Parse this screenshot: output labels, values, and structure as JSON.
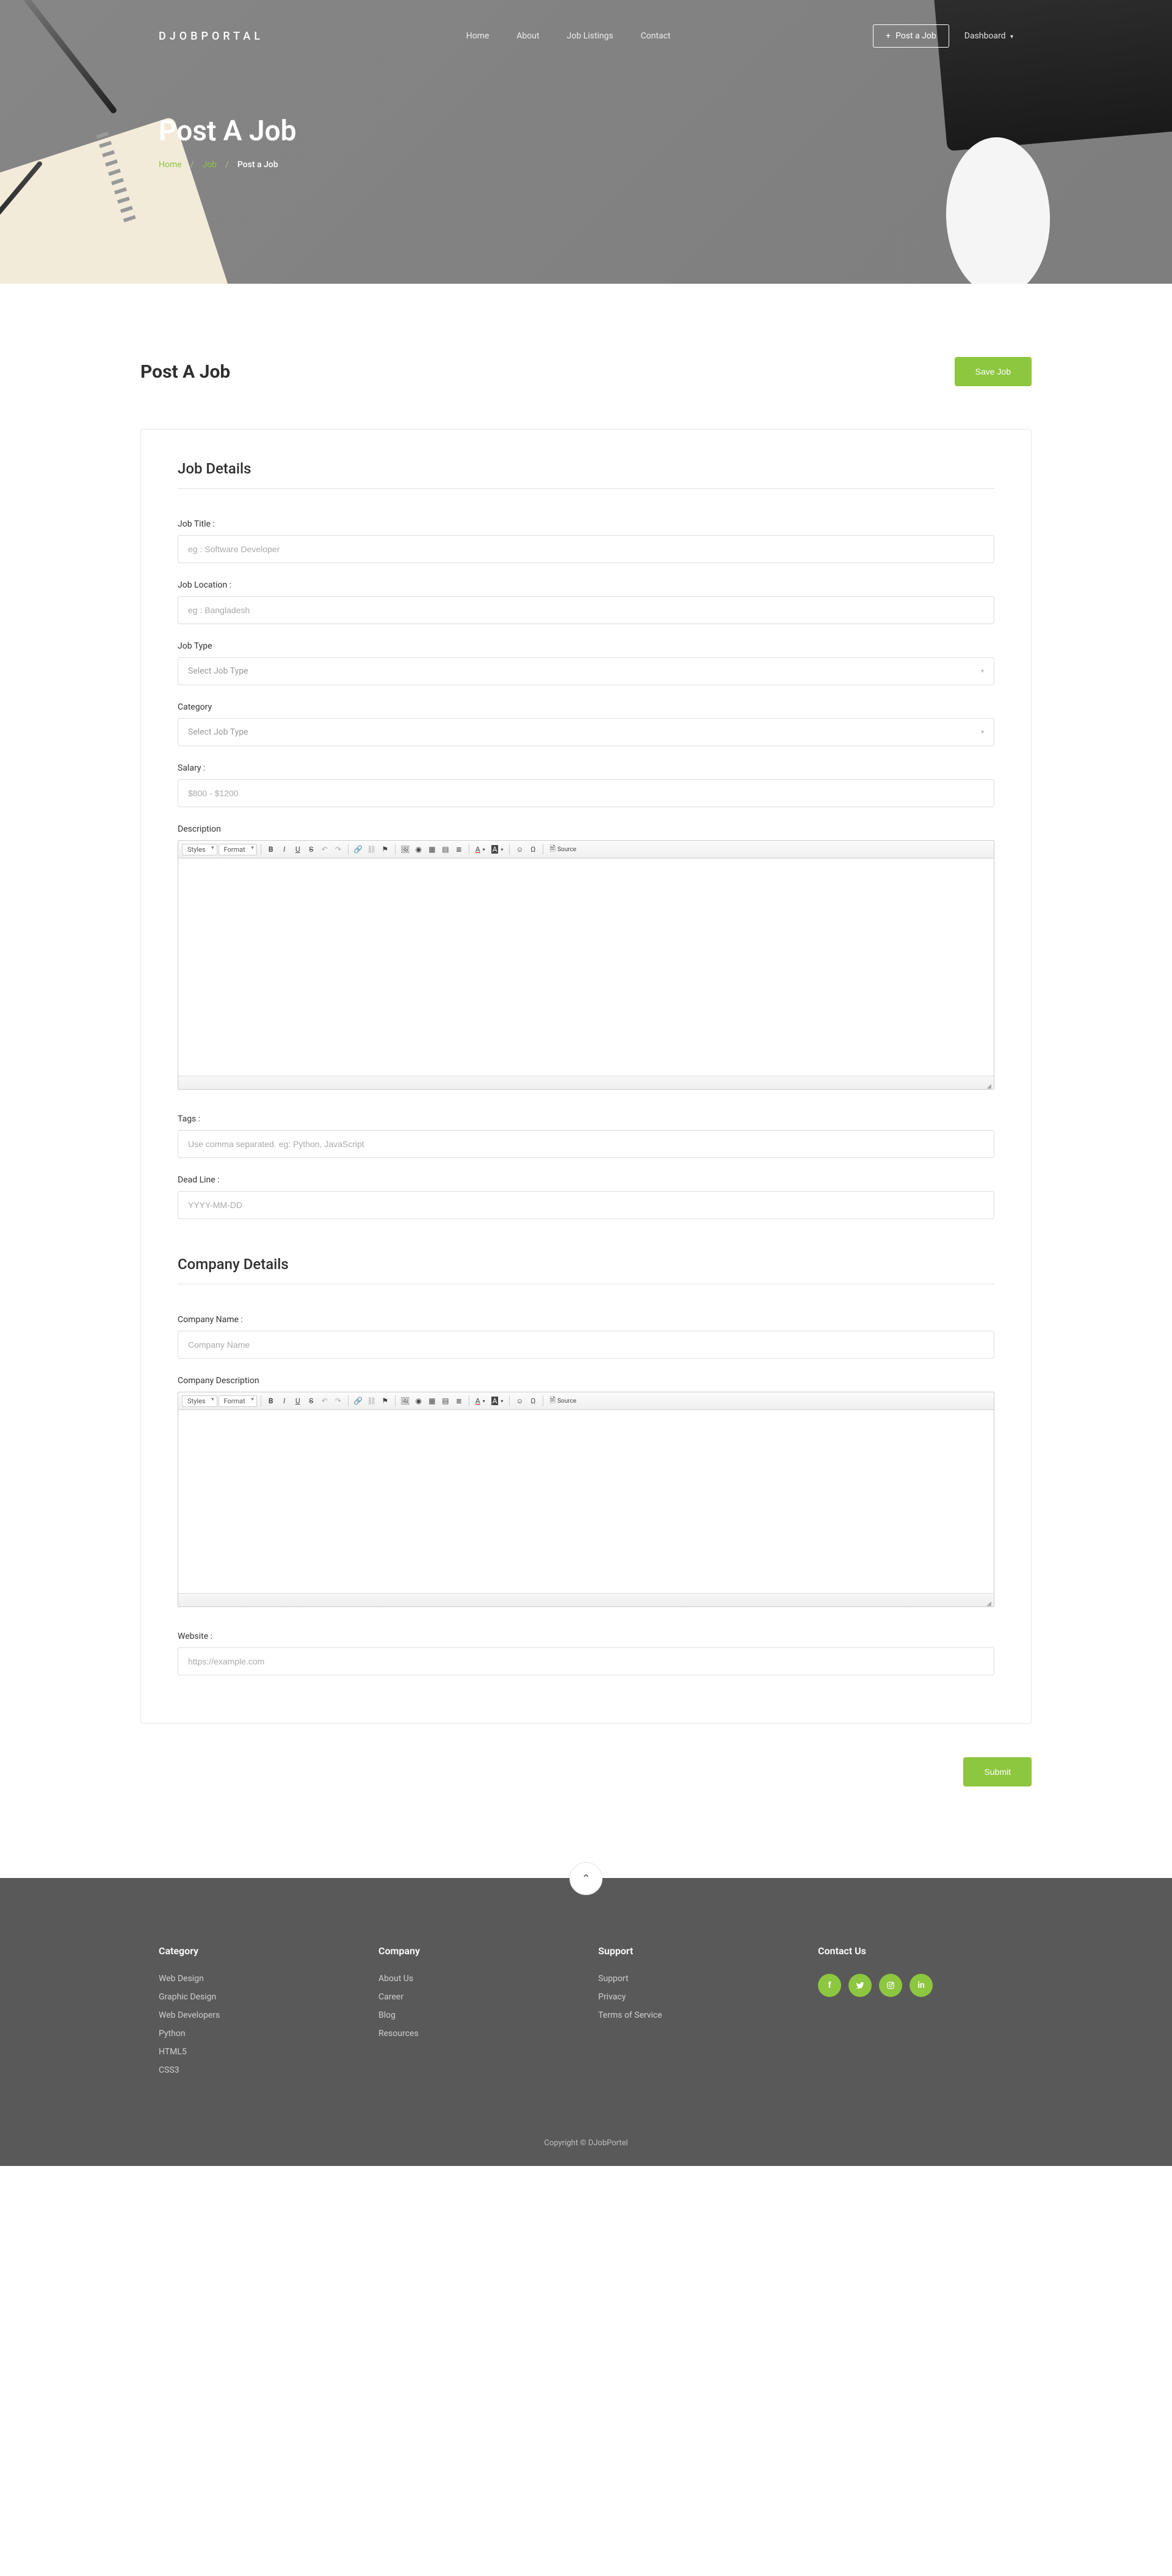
{
  "brand": "DJOBPORTAL",
  "nav": {
    "home": "Home",
    "about": "About",
    "jobs": "Job Listings",
    "contact": "Contact",
    "post": "Post a Job",
    "dash": "Dashboard"
  },
  "hero": {
    "title": "Post A Job"
  },
  "breadcrumb": {
    "home": "Home",
    "job": "Job",
    "current": "Post a Job"
  },
  "page": {
    "title": "Post A Job",
    "save": "Save Job",
    "submit": "Submit"
  },
  "sections": {
    "job": "Job Details",
    "company": "Company Details"
  },
  "labels": {
    "jobTitle": "Job Title :",
    "jobLocation": "Job Location :",
    "jobType": "Job Type",
    "category": "Category",
    "salary": "Salary :",
    "description": "Description",
    "tags": "Tags :",
    "deadline": "Dead Line :",
    "companyName": "Company Name :",
    "companyDesc": "Company Description",
    "website": "Website :"
  },
  "placeholders": {
    "jobTitle": "eg : Software Developer",
    "jobLocation": "eg : Bangladesh",
    "jobType": "Select Job Type",
    "category": "Select Job Type",
    "salary": "$800 - $1200",
    "tags": "Use comma separated. eg: Python, JavaScript",
    "deadline": "YYYY-MM-DD",
    "companyName": "Company Name",
    "website": "https://example.com"
  },
  "editor": {
    "styles": "Styles",
    "format": "Format",
    "source": "Source"
  },
  "footer": {
    "category": {
      "title": "Category",
      "items": [
        "Web Design",
        "Graphic Design",
        "Web Developers",
        "Python",
        "HTML5",
        "CSS3"
      ]
    },
    "company": {
      "title": "Company",
      "items": [
        "About Us",
        "Career",
        "Blog",
        "Resources"
      ]
    },
    "support": {
      "title": "Support",
      "items": [
        "Support",
        "Privacy",
        "Terms of Service"
      ]
    },
    "contact": {
      "title": "Contact Us"
    },
    "copyright": "Copyright © DJobPortel"
  }
}
